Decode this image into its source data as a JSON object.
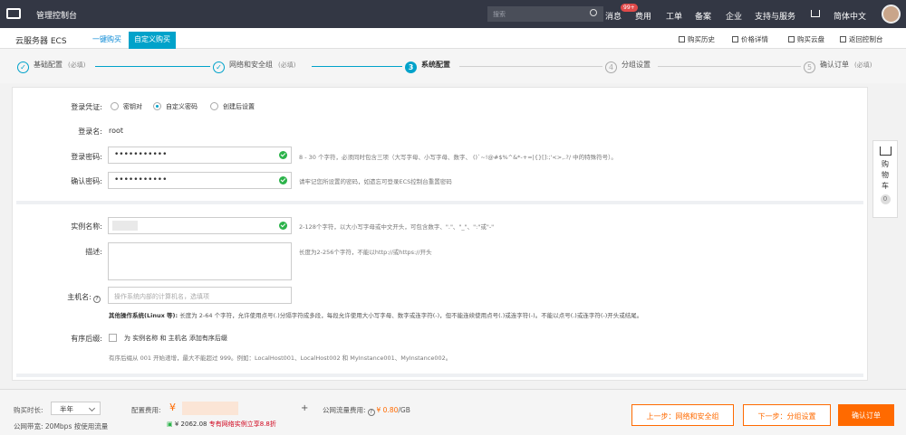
{
  "topbar": {
    "title": "管理控制台",
    "search_placeholder": "搜索",
    "nav": [
      "消息",
      "费用",
      "工单",
      "备案",
      "企业",
      "支持与服务",
      "简体中文"
    ],
    "badge": "99+"
  },
  "subbar": {
    "product": "云服务器 ECS",
    "tab_quick": "一键购买",
    "tab_custom": "自定义购买",
    "links": [
      "购买历史",
      "价格详情",
      "购买云盘",
      "返回控制台"
    ]
  },
  "steps": [
    {
      "num": "",
      "label": "基础配置",
      "opt": "(必填)"
    },
    {
      "num": "",
      "label": "网络和安全组",
      "opt": "(必填)"
    },
    {
      "num": "3",
      "label": "系统配置",
      "opt": ""
    },
    {
      "num": "4",
      "label": "分组设置",
      "opt": ""
    },
    {
      "num": "5",
      "label": "确认订单",
      "opt": "(必填)"
    }
  ],
  "login": {
    "credential_label": "登录凭证:",
    "options": [
      "密钥对",
      "自定义密码",
      "创建后设置"
    ],
    "username_label": "登录名:",
    "username": "root",
    "password_label": "登录密码:",
    "password": "•••••••••••",
    "password_hint": "8 - 30 个字符，必须同时包含三项（大写字母、小写字母、数字、 ()`~!@#$%^&*-+=|{}[]:;'<>,.?/ 中的特殊符号）。",
    "confirm_label": "确认密码:",
    "confirm": "•••••••••••",
    "confirm_hint": "请牢记您所设置的密码，如遗忘可登录ECS控制台重置密码"
  },
  "instance": {
    "name_label": "实例名称:",
    "name_hint": "2-128个字符，以大小写字母或中文开头，可包含数字、\".\"、\"_\"、\":\"或\"-\"",
    "desc_label": "描述:",
    "desc_hint": "长度为2-256个字符，不能以http://或https://开头",
    "host_label": "主机名:",
    "host_placeholder": "操作系统内部的计算机名，选填项",
    "host_rule_title": "其他操作系统(Linux 等):",
    "host_rule": "长度为 2-64 个字符，允许使用点号(.)分隔字符成多段，每段允许使用大小写字母、数字或连字符(-)，但不能连续使用点号(.)或连字符(-)。不能以点号(.)或连字符(-)开头或结尾。",
    "seq_label": "有序后缀:",
    "seq_option": "为 实例名称 和 主机名 添加有序后缀",
    "seq_hint": "有序后缀从 001 开始递增，最大不能超过 999。例如：LocalHost001、LocalHost002 和 MyInstance001、MyInstance002。"
  },
  "cart": {
    "label": [
      "购",
      "物",
      "车"
    ],
    "count": "0"
  },
  "bottom": {
    "duration_label": "购买时长:",
    "duration": "半年",
    "bandwidth": "公网带宽: 20Mbps 按使用流量",
    "config_fee_label": "配置费用:",
    "currency": "¥",
    "plus": "+",
    "traffic_label": "公网流量费用:",
    "traffic_price": "¥ 0.80",
    "traffic_unit": "/GB",
    "promo_price": "¥ 2062.08",
    "promo_text": "专有网络实例立享8.8折",
    "prev": "上一步：网络和安全组",
    "next": "下一步：分组设置",
    "confirm": "确认订单"
  }
}
